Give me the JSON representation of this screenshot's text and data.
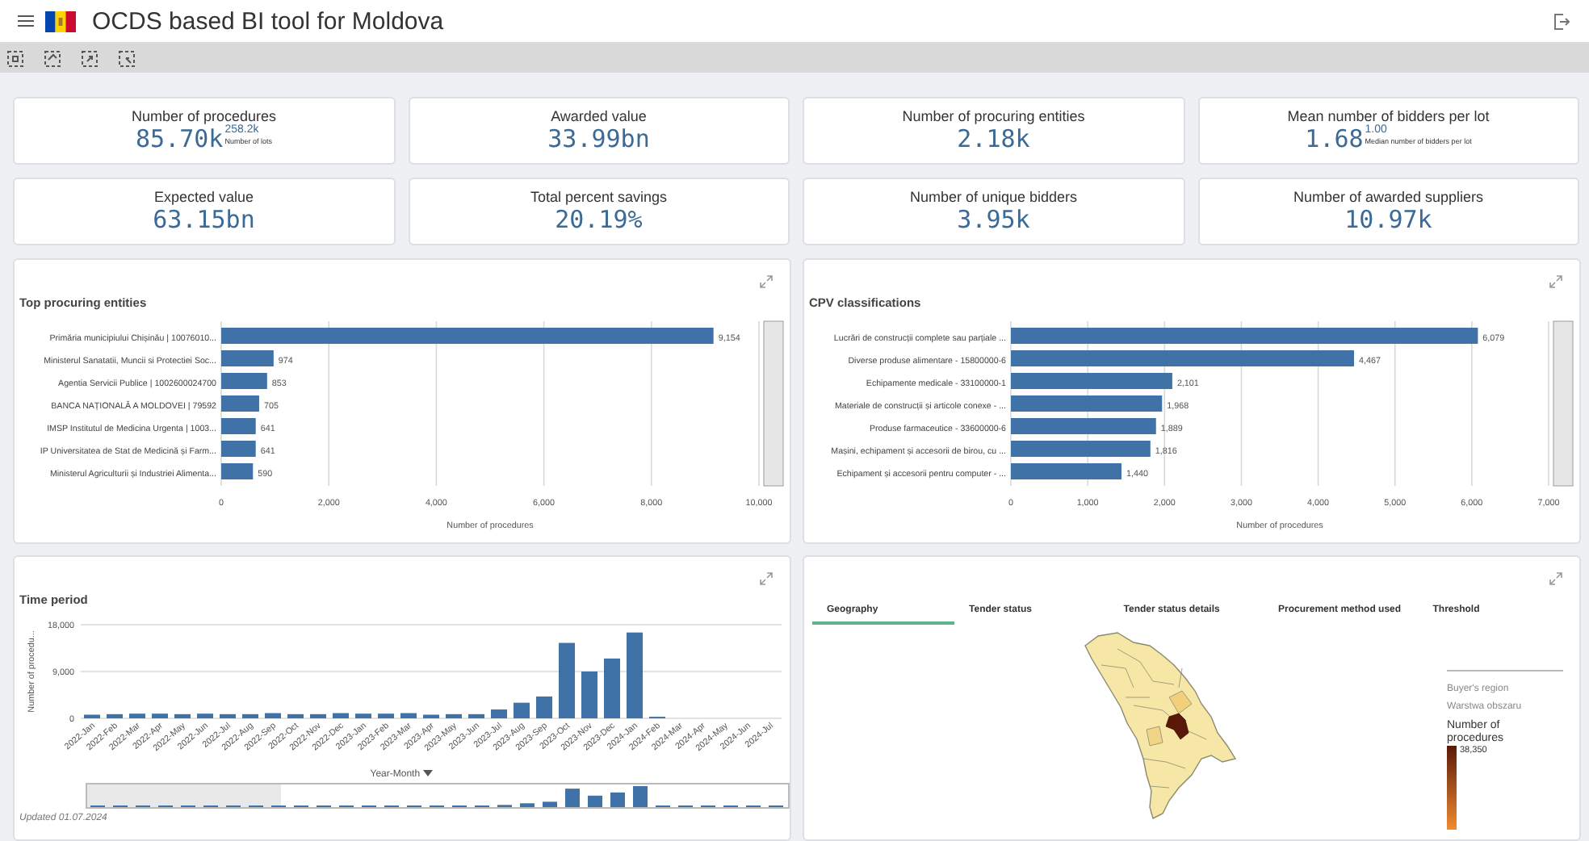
{
  "header": {
    "title": "OCDS based BI tool for Moldova"
  },
  "kpi_rows": [
    [
      {
        "label": "Number of procedures",
        "value": "85.70k",
        "sup": "258.2k",
        "note": "Number of lots"
      },
      {
        "label": "Awarded value",
        "value": "33.99bn"
      },
      {
        "label": "Number of procuring entities",
        "value": "2.18k"
      },
      {
        "label": "Mean number of bidders per lot",
        "value": "1.68",
        "sup": "1.00",
        "note": "Median number of bidders per lot"
      }
    ],
    [
      {
        "label": "Expected value",
        "value": "63.15bn"
      },
      {
        "label": "Total percent savings",
        "value": "20.19%"
      },
      {
        "label": "Number of unique bidders",
        "value": "3.95k"
      },
      {
        "label": "Number of awarded suppliers",
        "value": "10.97k"
      }
    ]
  ],
  "bar_panels": [
    {
      "title": "Top procuring entities",
      "chart_data": {
        "type": "bar",
        "orientation": "horizontal",
        "xlabel": "Number of procedures",
        "grid": true,
        "value_labels": [
          "9,154",
          "974",
          "853",
          "705",
          "641",
          "641",
          "590"
        ],
        "categories": [
          "Primăria municipiului Chișinău | 10076010...",
          "Ministerul Sanatatii, Muncii si Protectiei Soc...",
          "Agentia Servicii Publice | 1002600024700",
          "BANCA NAȚIONALĂ A MOLDOVEI | 79592",
          "IMSP Institutul de Medicina Urgenta | 1003...",
          "IP Universitatea de Stat de Medicină și Farm...",
          "Ministerul Agriculturii și Industriei Alimenta..."
        ],
        "values": [
          9154,
          974,
          853,
          705,
          641,
          641,
          590
        ],
        "xlim": [
          0,
          10000
        ],
        "xticks": [
          {
            "value": 0,
            "label": "0"
          },
          {
            "value": 2000,
            "label": "2,000"
          },
          {
            "value": 4000,
            "label": "4,000"
          },
          {
            "value": 6000,
            "label": "6,000"
          },
          {
            "value": 8000,
            "label": "8,000"
          },
          {
            "value": 10000,
            "label": "10,000"
          }
        ]
      }
    },
    {
      "title": "CPV classifications",
      "chart_data": {
        "type": "bar",
        "orientation": "horizontal",
        "xlabel": "Number of procedures",
        "grid": true,
        "value_labels": [
          "6,079",
          "4,467",
          "2,101",
          "1,968",
          "1,889",
          "1,816",
          "1,440"
        ],
        "categories": [
          "Lucrări de construcții complete sau parțiale ...",
          "Diverse produse alimentare - 15800000-6",
          "Echipamente medicale - 33100000-1",
          "Materiale de construcții și articole conexe - ...",
          "Produse farmaceutice - 33600000-6",
          "Mașini, echipament și accesorii de birou, cu ...",
          "Echipament și accesorii pentru computer - ..."
        ],
        "values": [
          6079,
          4467,
          2101,
          1968,
          1889,
          1816,
          1440
        ],
        "xlim": [
          0,
          7000
        ],
        "xticks": [
          {
            "value": 0,
            "label": "0"
          },
          {
            "value": 1000,
            "label": "1,000"
          },
          {
            "value": 2000,
            "label": "2,000"
          },
          {
            "value": 3000,
            "label": "3,000"
          },
          {
            "value": 4000,
            "label": "4,000"
          },
          {
            "value": 5000,
            "label": "5,000"
          },
          {
            "value": 6000,
            "label": "6,000"
          },
          {
            "value": 7000,
            "label": "7,000"
          }
        ]
      }
    }
  ],
  "time_panel": {
    "title": "Time period",
    "chart_data": {
      "type": "bar",
      "ylabel": "Number of procedu...",
      "xlabel": "Year-Month",
      "categories": [
        "2022-Jan",
        "2022-Feb",
        "2022-Mar",
        "2022-Apr",
        "2022-May",
        "2022-Jun",
        "2022-Jul",
        "2022-Aug",
        "2022-Sep",
        "2022-Oct",
        "2022-Nov",
        "2022-Dec",
        "2023-Jan",
        "2023-Feb",
        "2023-Mar",
        "2023-Apr",
        "2023-May",
        "2023-Jun",
        "2023-Jul",
        "2023-Aug",
        "2023-Sep",
        "2023-Oct",
        "2023-Nov",
        "2023-Dec",
        "2024-Jan",
        "2024-Feb",
        "2024-Mar",
        "2024-Apr",
        "2024-May",
        "2024-Jun",
        "2024-Jul"
      ],
      "values": [
        700,
        800,
        900,
        900,
        800,
        900,
        800,
        800,
        1000,
        800,
        800,
        1000,
        900,
        900,
        1000,
        700,
        800,
        800,
        1700,
        3000,
        4200,
        14500,
        9000,
        11500,
        16500,
        300,
        0,
        0,
        0,
        0,
        0
      ],
      "ylim": [
        0,
        18000
      ],
      "yticks": [
        {
          "value": 0,
          "label": "0"
        },
        {
          "value": 9000,
          "label": "9,000"
        },
        {
          "value": 18000,
          "label": "18,000"
        }
      ]
    },
    "updated": "Updated 01.07.2024"
  },
  "map_panel": {
    "tabs": [
      {
        "label": "Geography",
        "selected": true
      },
      {
        "label": "Tender status",
        "selected": false
      },
      {
        "label": "Tender status details",
        "selected": false
      },
      {
        "label": "Procurement method used",
        "selected": false
      },
      {
        "label": "Threshold",
        "selected": false
      }
    ],
    "legend": {
      "layer": "Buyer's region",
      "layer_name": "Warstwa obszaru",
      "title": "Number of procedures",
      "max": "38,350"
    }
  }
}
